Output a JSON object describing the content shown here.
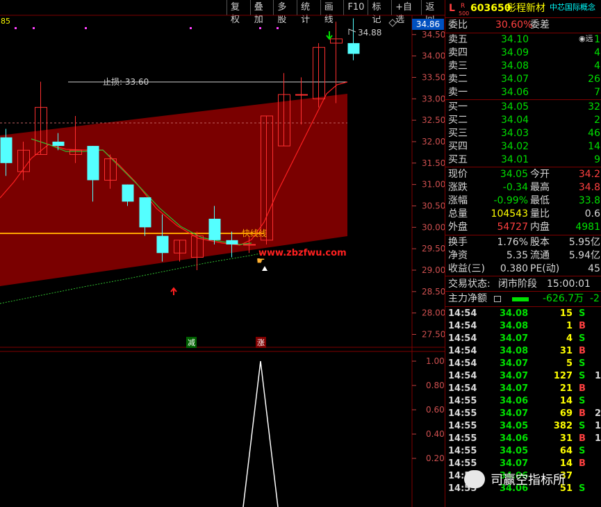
{
  "toolbar": {
    "buttons": [
      "复权",
      "叠加",
      "多股",
      "统计",
      "画线",
      "F10",
      "标记",
      "+自选",
      "返回"
    ]
  },
  "stock": {
    "flag": "L",
    "badge_top": "R",
    "badge_bottom": "500",
    "code": "603650",
    "name": "彤程新材",
    "concept": "中芯国际概念"
  },
  "chart": {
    "top_left_label": "85",
    "current_price_tag": "34.86",
    "high_label": "34.88",
    "stop_loss_label": "止损: 33.60",
    "middle_line_label": "快线线",
    "watermark": "www.zbzfwu.com",
    "sub_label_down": "减",
    "sub_label_up": "涨",
    "price_axis": [
      "34.50",
      "34.00",
      "33.50",
      "33.00",
      "32.50",
      "32.00",
      "31.50",
      "31.00",
      "30.50",
      "30.00",
      "29.50",
      "29.00",
      "28.50",
      "28.00",
      "27.50"
    ],
    "sub_axis": [
      "1.00",
      "0.80",
      "0.60",
      "0.40",
      "0.20"
    ]
  },
  "chart_data": {
    "type": "candlestick",
    "ylim": [
      27.2,
      34.95
    ],
    "candles": [
      {
        "o": 31.5,
        "h": 32.3,
        "l": 31.2,
        "c": 32.1,
        "up": false
      },
      {
        "o": 31.3,
        "h": 32.0,
        "l": 31.1,
        "c": 31.8,
        "up": true
      },
      {
        "o": 31.7,
        "h": 33.4,
        "l": 31.7,
        "c": 32.8,
        "up": true
      },
      {
        "o": 32.0,
        "h": 32.2,
        "l": 31.8,
        "c": 31.9,
        "up": false
      },
      {
        "o": 31.8,
        "h": 32.6,
        "l": 31.5,
        "c": 31.7,
        "up": true
      },
      {
        "o": 31.9,
        "h": 31.9,
        "l": 30.6,
        "c": 31.1,
        "up": false
      },
      {
        "o": 31.1,
        "h": 31.7,
        "l": 30.9,
        "c": 31.6,
        "up": true
      },
      {
        "o": 31.0,
        "h": 31.0,
        "l": 30.5,
        "c": 30.6,
        "up": false
      },
      {
        "o": 30.7,
        "h": 30.7,
        "l": 29.8,
        "c": 30.0,
        "up": false
      },
      {
        "o": 29.8,
        "h": 30.3,
        "l": 29.2,
        "c": 29.4,
        "up": false
      },
      {
        "o": 29.4,
        "h": 29.7,
        "l": 29.2,
        "c": 29.7,
        "up": true
      },
      {
        "o": 29.3,
        "h": 29.9,
        "l": 29.0,
        "c": 29.8,
        "up": true
      },
      {
        "o": 30.2,
        "h": 30.5,
        "l": 29.6,
        "c": 29.7,
        "up": false
      },
      {
        "o": 29.7,
        "h": 29.9,
        "l": 29.3,
        "c": 29.6,
        "up": false
      },
      {
        "o": 29.6,
        "h": 29.8,
        "l": 29.4,
        "c": 29.6,
        "up": true
      },
      {
        "o": 29.7,
        "h": 32.6,
        "l": 29.6,
        "c": 32.6,
        "up": true
      },
      {
        "o": 31.9,
        "h": 33.6,
        "l": 31.9,
        "c": 33.1,
        "up": true
      },
      {
        "o": 33.1,
        "h": 33.5,
        "l": 32.4,
        "c": 33.1,
        "up": true
      },
      {
        "o": 33.0,
        "h": 34.3,
        "l": 32.8,
        "c": 34.2,
        "up": true
      },
      {
        "o": 34.3,
        "h": 34.8,
        "l": 32.9,
        "c": 34.4,
        "up": true
      },
      {
        "o": 34.3,
        "h": 34.88,
        "l": 33.9,
        "c": 34.05,
        "up": false
      }
    ]
  },
  "quote": {
    "weibi_label": "委比",
    "weibi_value": "30.60%",
    "weicha_label": "委差",
    "sells": [
      {
        "label": "卖五",
        "price": "34.10",
        "vol": "1"
      },
      {
        "label": "卖四",
        "price": "34.09",
        "vol": "4"
      },
      {
        "label": "卖三",
        "price": "34.08",
        "vol": "4"
      },
      {
        "label": "卖二",
        "price": "34.07",
        "vol": "26"
      },
      {
        "label": "卖一",
        "price": "34.06",
        "vol": "7"
      }
    ],
    "buys": [
      {
        "label": "买一",
        "price": "34.05",
        "vol": "32"
      },
      {
        "label": "买二",
        "price": "34.04",
        "vol": "2"
      },
      {
        "label": "买三",
        "price": "34.03",
        "vol": "46"
      },
      {
        "label": "买四",
        "price": "34.02",
        "vol": "14"
      },
      {
        "label": "买五",
        "price": "34.01",
        "vol": "9"
      }
    ],
    "stats": [
      {
        "l1": "现价",
        "v1": "34.05",
        "l2": "今开",
        "v2": "34.2",
        "c1": "g",
        "c2": "r"
      },
      {
        "l1": "涨跌",
        "v1": "-0.34",
        "l2": "最高",
        "v2": "34.8",
        "c1": "g",
        "c2": "r"
      },
      {
        "l1": "涨幅",
        "v1": "-0.99%",
        "l2": "最低",
        "v2": "33.8",
        "c1": "g",
        "c2": "g"
      },
      {
        "l1": "总量",
        "v1": "104543",
        "l2": "量比",
        "v2": "0.6",
        "c1": "y",
        "c2": "w"
      },
      {
        "l1": "外盘",
        "v1": "54727",
        "l2": "内盘",
        "v2": "4981",
        "c1": "r",
        "c2": "g"
      }
    ],
    "stats2": [
      {
        "l1": "换手",
        "v1": "1.76%",
        "l2": "股本",
        "v2": "5.95亿"
      },
      {
        "l1": "净资",
        "v1": "5.35",
        "l2": "流通",
        "v2": "5.94亿"
      },
      {
        "l1": "收益(三)",
        "v1": "0.380",
        "l2": "PE(动)",
        "v2": "45"
      }
    ],
    "trade_status_label": "交易状态:",
    "trade_status_value": "闭市阶段",
    "trade_time": "15:00:01",
    "net_flow_label": "主力净额",
    "net_flow_value": "-626.7万",
    "net_flow_pct": "-2"
  },
  "ticks": [
    {
      "t": "14:54",
      "p": "34.08",
      "v": "15",
      "s": "S",
      "e": ""
    },
    {
      "t": "14:54",
      "p": "34.08",
      "v": "1",
      "s": "B",
      "e": ""
    },
    {
      "t": "14:54",
      "p": "34.07",
      "v": "4",
      "s": "S",
      "e": ""
    },
    {
      "t": "14:54",
      "p": "34.08",
      "v": "31",
      "s": "B",
      "e": ""
    },
    {
      "t": "14:54",
      "p": "34.07",
      "v": "5",
      "s": "S",
      "e": ""
    },
    {
      "t": "14:54",
      "p": "34.07",
      "v": "127",
      "s": "S",
      "e": "1"
    },
    {
      "t": "14:54",
      "p": "34.07",
      "v": "21",
      "s": "B",
      "e": ""
    },
    {
      "t": "14:55",
      "p": "34.06",
      "v": "14",
      "s": "S",
      "e": ""
    },
    {
      "t": "14:55",
      "p": "34.07",
      "v": "69",
      "s": "B",
      "e": "2"
    },
    {
      "t": "14:55",
      "p": "34.05",
      "v": "382",
      "s": "S",
      "e": "1"
    },
    {
      "t": "14:55",
      "p": "34.06",
      "v": "31",
      "s": "B",
      "e": "1"
    },
    {
      "t": "14:55",
      "p": "34.05",
      "v": "64",
      "s": "S",
      "e": ""
    },
    {
      "t": "14:55",
      "p": "34.07",
      "v": "14",
      "s": "B",
      "e": ""
    },
    {
      "t": "14:55",
      "p": "34.06",
      "v": "37",
      "s": "",
      "e": ""
    },
    {
      "t": "14:55",
      "p": "34.06",
      "v": "51",
      "s": "S",
      "e": ""
    }
  ],
  "wechat": {
    "account": "司赢空指标所"
  },
  "colors": {
    "up": "#ff3030",
    "down": "#54ffff",
    "band": "#7a0000",
    "ma_fast": "#ff2020",
    "ma_slow": "#30c030",
    "orange": "#ffa500"
  }
}
